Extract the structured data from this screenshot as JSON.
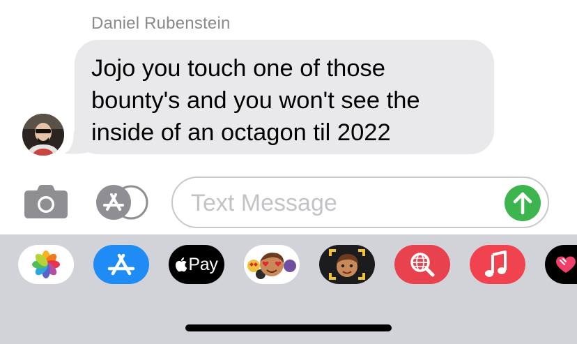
{
  "conversation": {
    "sender_name": "Daniel Rubenstein",
    "message": {
      "lines": [
        "Jojo you touch one of those",
        "bounty's and you won't see the",
        "inside of an octagon til 2022"
      ]
    }
  },
  "composer": {
    "placeholder": "Text Message",
    "value": "",
    "camera_icon": "camera-icon",
    "apps_icon": "app-store-icon",
    "send_icon": "arrow-up-icon",
    "send_color": "#3cb54f"
  },
  "app_drawer": {
    "apps": [
      {
        "name": "Photos",
        "icon": "photos-icon",
        "bg": "#ffffff"
      },
      {
        "name": "App Store",
        "icon": "app-store-icon",
        "bg": "#1f8cf5"
      },
      {
        "name": "Apple Pay",
        "icon": "apple-pay-icon",
        "bg": "#000000",
        "label": "Pay"
      },
      {
        "name": "Memoji Stickers",
        "icon": "memoji-stickers-icon",
        "bg": "#ffffff"
      },
      {
        "name": "Memoji",
        "icon": "memoji-icon",
        "bg": "#1c1c1e"
      },
      {
        "name": "Image Search",
        "icon": "globe-search-icon",
        "bg": "#e8424f"
      },
      {
        "name": "Music",
        "icon": "music-icon",
        "bg": "#f1434f"
      },
      {
        "name": "Digital Touch",
        "icon": "digital-touch-icon",
        "bg": "#000000"
      }
    ]
  }
}
